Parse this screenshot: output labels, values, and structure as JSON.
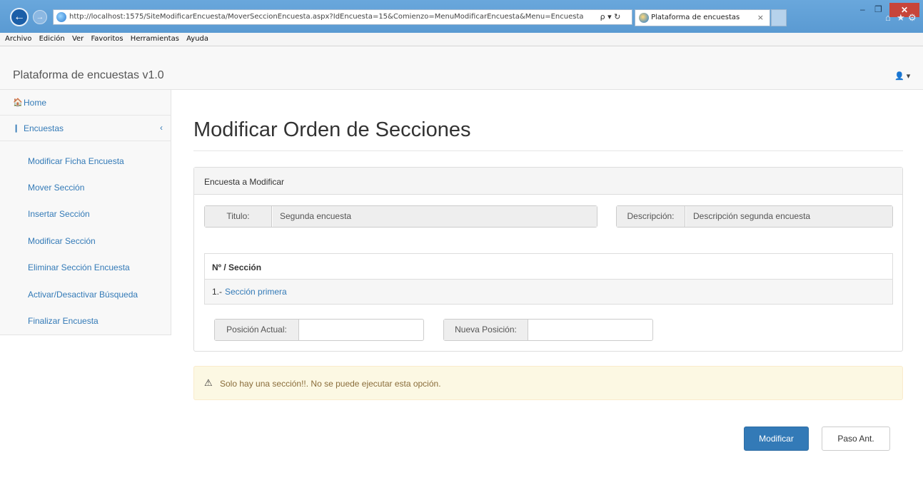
{
  "browser": {
    "url": "http://localhost:1575/SiteModificarEncuesta/MoverSeccionEncuesta.aspx?IdEncuesta=15&Comienzo=MenuModificarEncuesta&Menu=Encuesta",
    "tab_title": "Plataforma de encuestas",
    "tab_close": "×",
    "search_controls": "ρ ▾ ↻",
    "menu": [
      "Archivo",
      "Edición",
      "Ver",
      "Favoritos",
      "Herramientas",
      "Ayuda"
    ]
  },
  "header": {
    "brand": "Plataforma de encuestas v1.0",
    "user_icon": "user-icon"
  },
  "sidebar": {
    "home": "Home",
    "encuestas": "Encuestas",
    "items": [
      "Modificar Ficha Encuesta",
      "Mover Sección",
      "Insertar Sección",
      "Modificar Sección",
      "Eliminar Sección Encuesta",
      "Activar/Desactivar Búsqueda",
      "Finalizar Encuesta"
    ]
  },
  "main": {
    "title": "Modificar Orden de Secciones",
    "panel_title": "Encuesta a Modificar",
    "titulo_label": "Titulo:",
    "titulo_value": "Segunda encuesta",
    "descripcion_label": "Descripción:",
    "descripcion_value": "Descripción segunda encuesta",
    "table_header": "Nº / Sección",
    "row_number": "1.-",
    "row_link": "Sección primera",
    "posicion_actual_label": "Posición Actual:",
    "posicion_actual_value": "",
    "nueva_posicion_label": "Nueva Posición:",
    "nueva_posicion_value": ""
  },
  "alert": {
    "message": "Solo hay una sección!!. No se puede ejecutar esta opción."
  },
  "buttons": {
    "modificar": "Modificar",
    "paso_ant": "Paso Ant."
  },
  "colors": {
    "primary": "#337ab7",
    "warning_bg": "#fcf8e3",
    "warning_text": "#8a6d3b"
  }
}
